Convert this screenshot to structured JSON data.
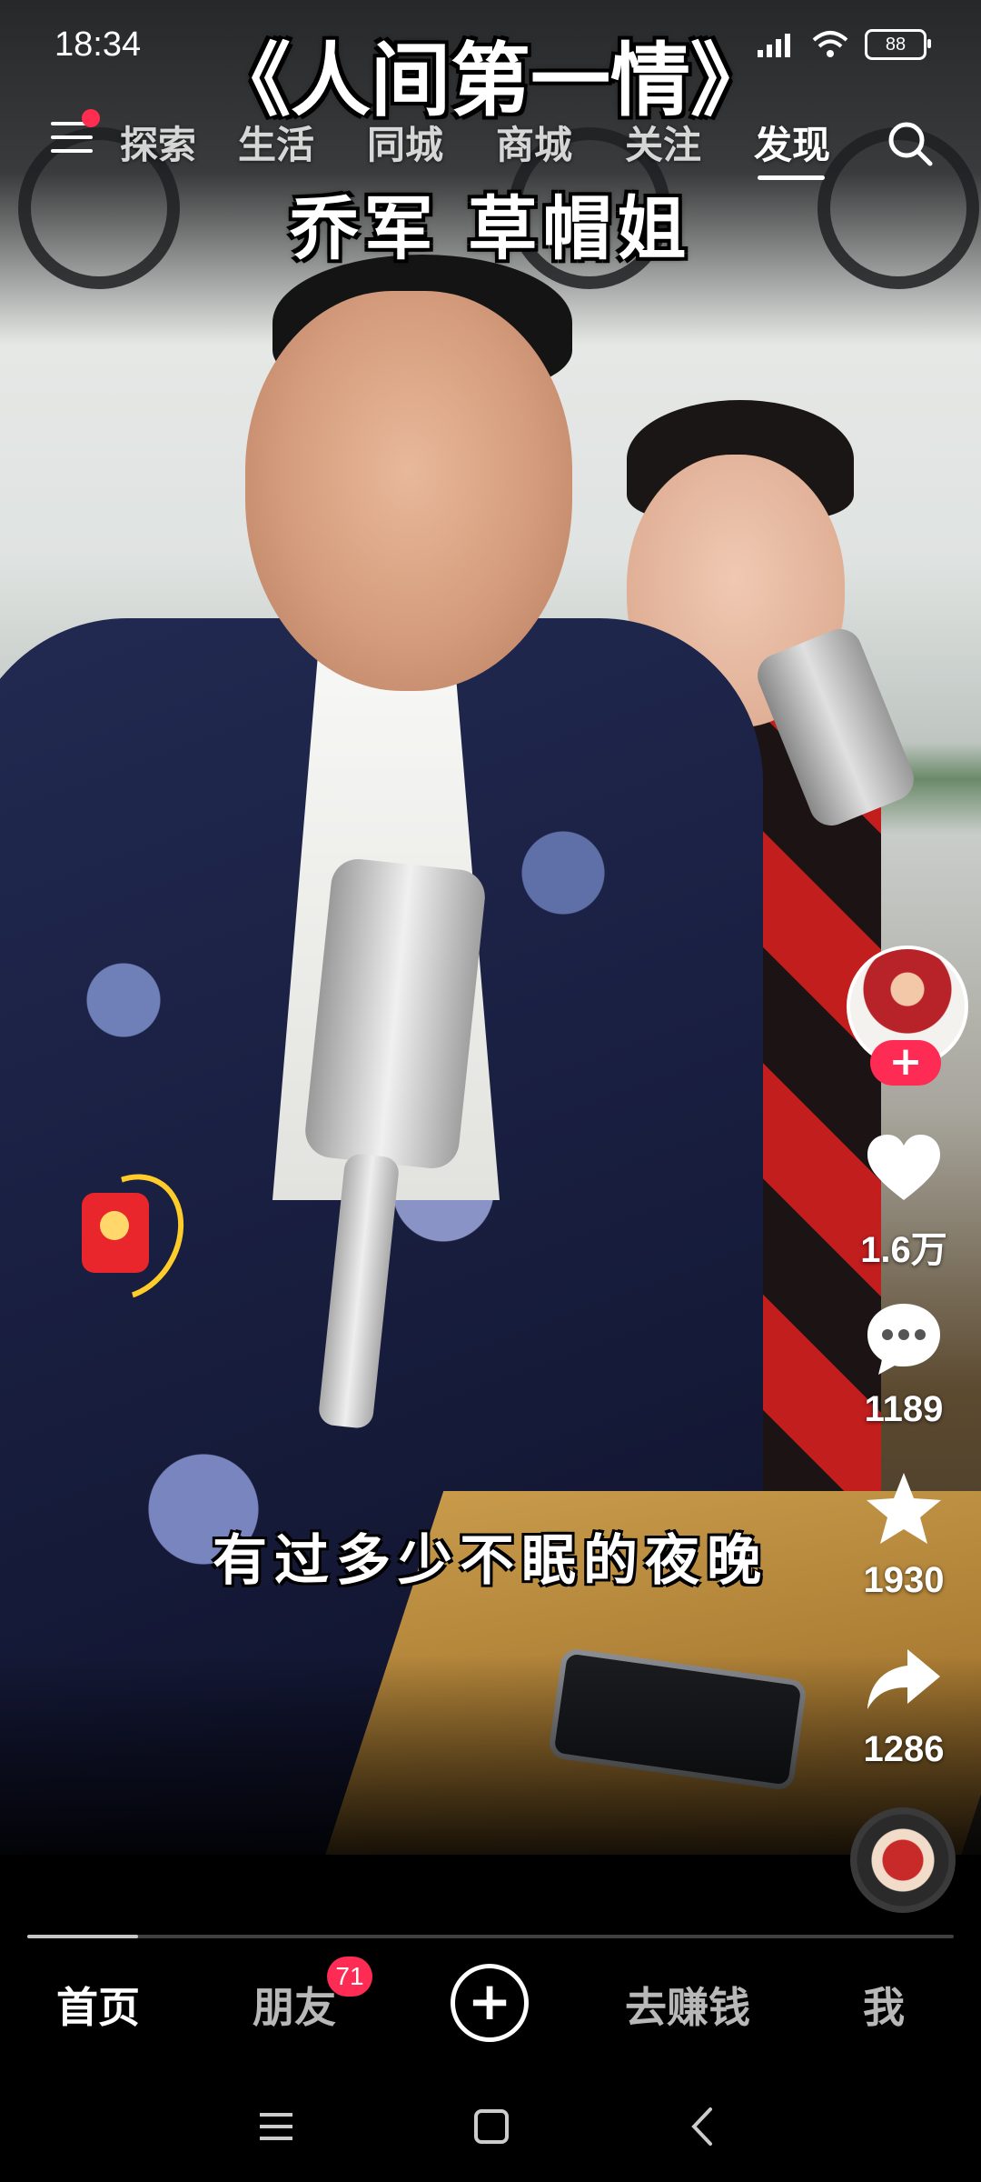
{
  "status_bar": {
    "time": "18:34",
    "battery": "88"
  },
  "video": {
    "title": "《人间第一情》",
    "subtitle_names": "乔军 草帽姐",
    "caption": "有过多少不眠的夜晚"
  },
  "top_nav": {
    "tabs": [
      {
        "label": "探索"
      },
      {
        "label": "生活"
      },
      {
        "label": "同城"
      },
      {
        "label": "商城"
      },
      {
        "label": "关注"
      },
      {
        "label": "发现",
        "active": true
      }
    ],
    "icons": {
      "menu": "menu-icon",
      "search": "search-icon"
    }
  },
  "actions": {
    "follow": "+",
    "likes": "1.6万",
    "comments": "1189",
    "favorites": "1930",
    "shares": "1286"
  },
  "progress": {
    "fraction": 0.12
  },
  "bottom_nav": {
    "home": "首页",
    "friends": "朋友",
    "friends_badge": "71",
    "create": "+",
    "earn": "去赚钱",
    "me": "我"
  },
  "colors": {
    "accent": "#fe2c55",
    "ring": "#ffcd2a"
  }
}
